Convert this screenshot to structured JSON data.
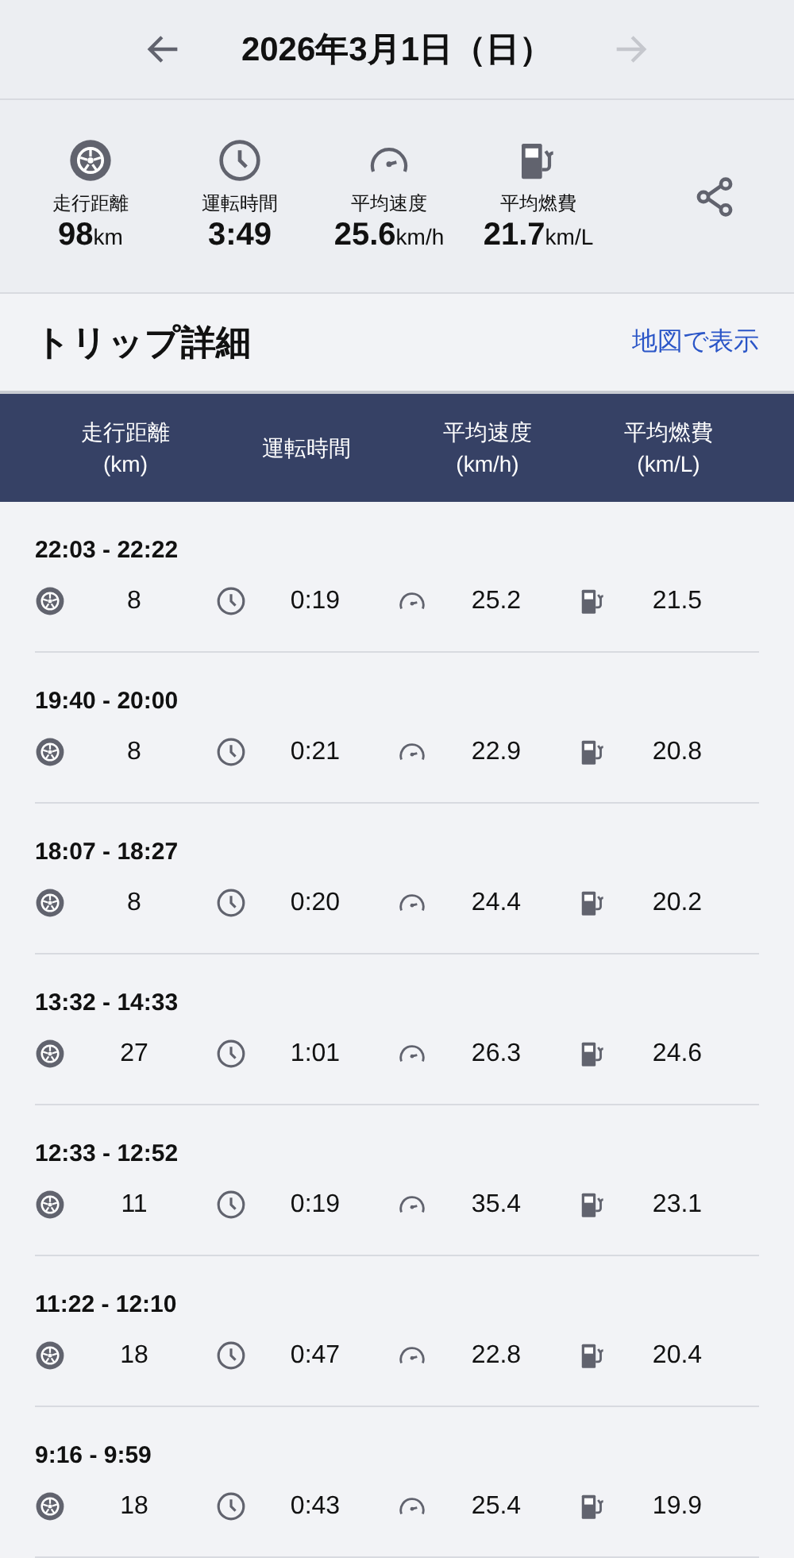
{
  "header": {
    "title": "2026年3月1日（日）",
    "prev": {
      "disabled": false
    },
    "next": {
      "disabled": true
    }
  },
  "summary": [
    {
      "kind": "distance",
      "label": "走行距離",
      "value": "98",
      "unit": "km"
    },
    {
      "kind": "time",
      "label": "運転時間",
      "value": "3:49"
    },
    {
      "kind": "speed",
      "label": "平均速度",
      "value": "25.6",
      "unit": "km/h"
    },
    {
      "kind": "fuel",
      "label": "平均燃費",
      "value": "21.7",
      "unit": "km/L"
    }
  ],
  "section": {
    "title": "トリップ詳細",
    "link": "地図で表示"
  },
  "table": {
    "columns": [
      {
        "kind": "distance",
        "label": "走行距離",
        "unit": "(km)"
      },
      {
        "kind": "time",
        "label": "運転時間"
      },
      {
        "kind": "speed",
        "label": "平均速度",
        "unit": "(km/h)"
      },
      {
        "kind": "fuel",
        "label": "平均燃費",
        "unit": "(km/L)"
      }
    ],
    "rows": [
      {
        "time_range": "22:03 - 22:22",
        "values": [
          "8",
          "0:19",
          "25.2",
          "21.5"
        ]
      },
      {
        "time_range": "19:40 - 20:00",
        "values": [
          "8",
          "0:21",
          "22.9",
          "20.8"
        ]
      },
      {
        "time_range": "18:07 - 18:27",
        "values": [
          "8",
          "0:20",
          "24.4",
          "20.2"
        ]
      },
      {
        "time_range": "13:32 - 14:33",
        "values": [
          "27",
          "1:01",
          "26.3",
          "24.6"
        ]
      },
      {
        "time_range": "12:33 - 12:52",
        "values": [
          "11",
          "0:19",
          "35.4",
          "23.1"
        ]
      },
      {
        "time_range": "11:22 - 12:10",
        "values": [
          "18",
          "0:47",
          "22.8",
          "20.4"
        ]
      },
      {
        "time_range": "9:16 - 9:59",
        "values": [
          "18",
          "0:43",
          "25.4",
          "19.9"
        ]
      }
    ]
  }
}
